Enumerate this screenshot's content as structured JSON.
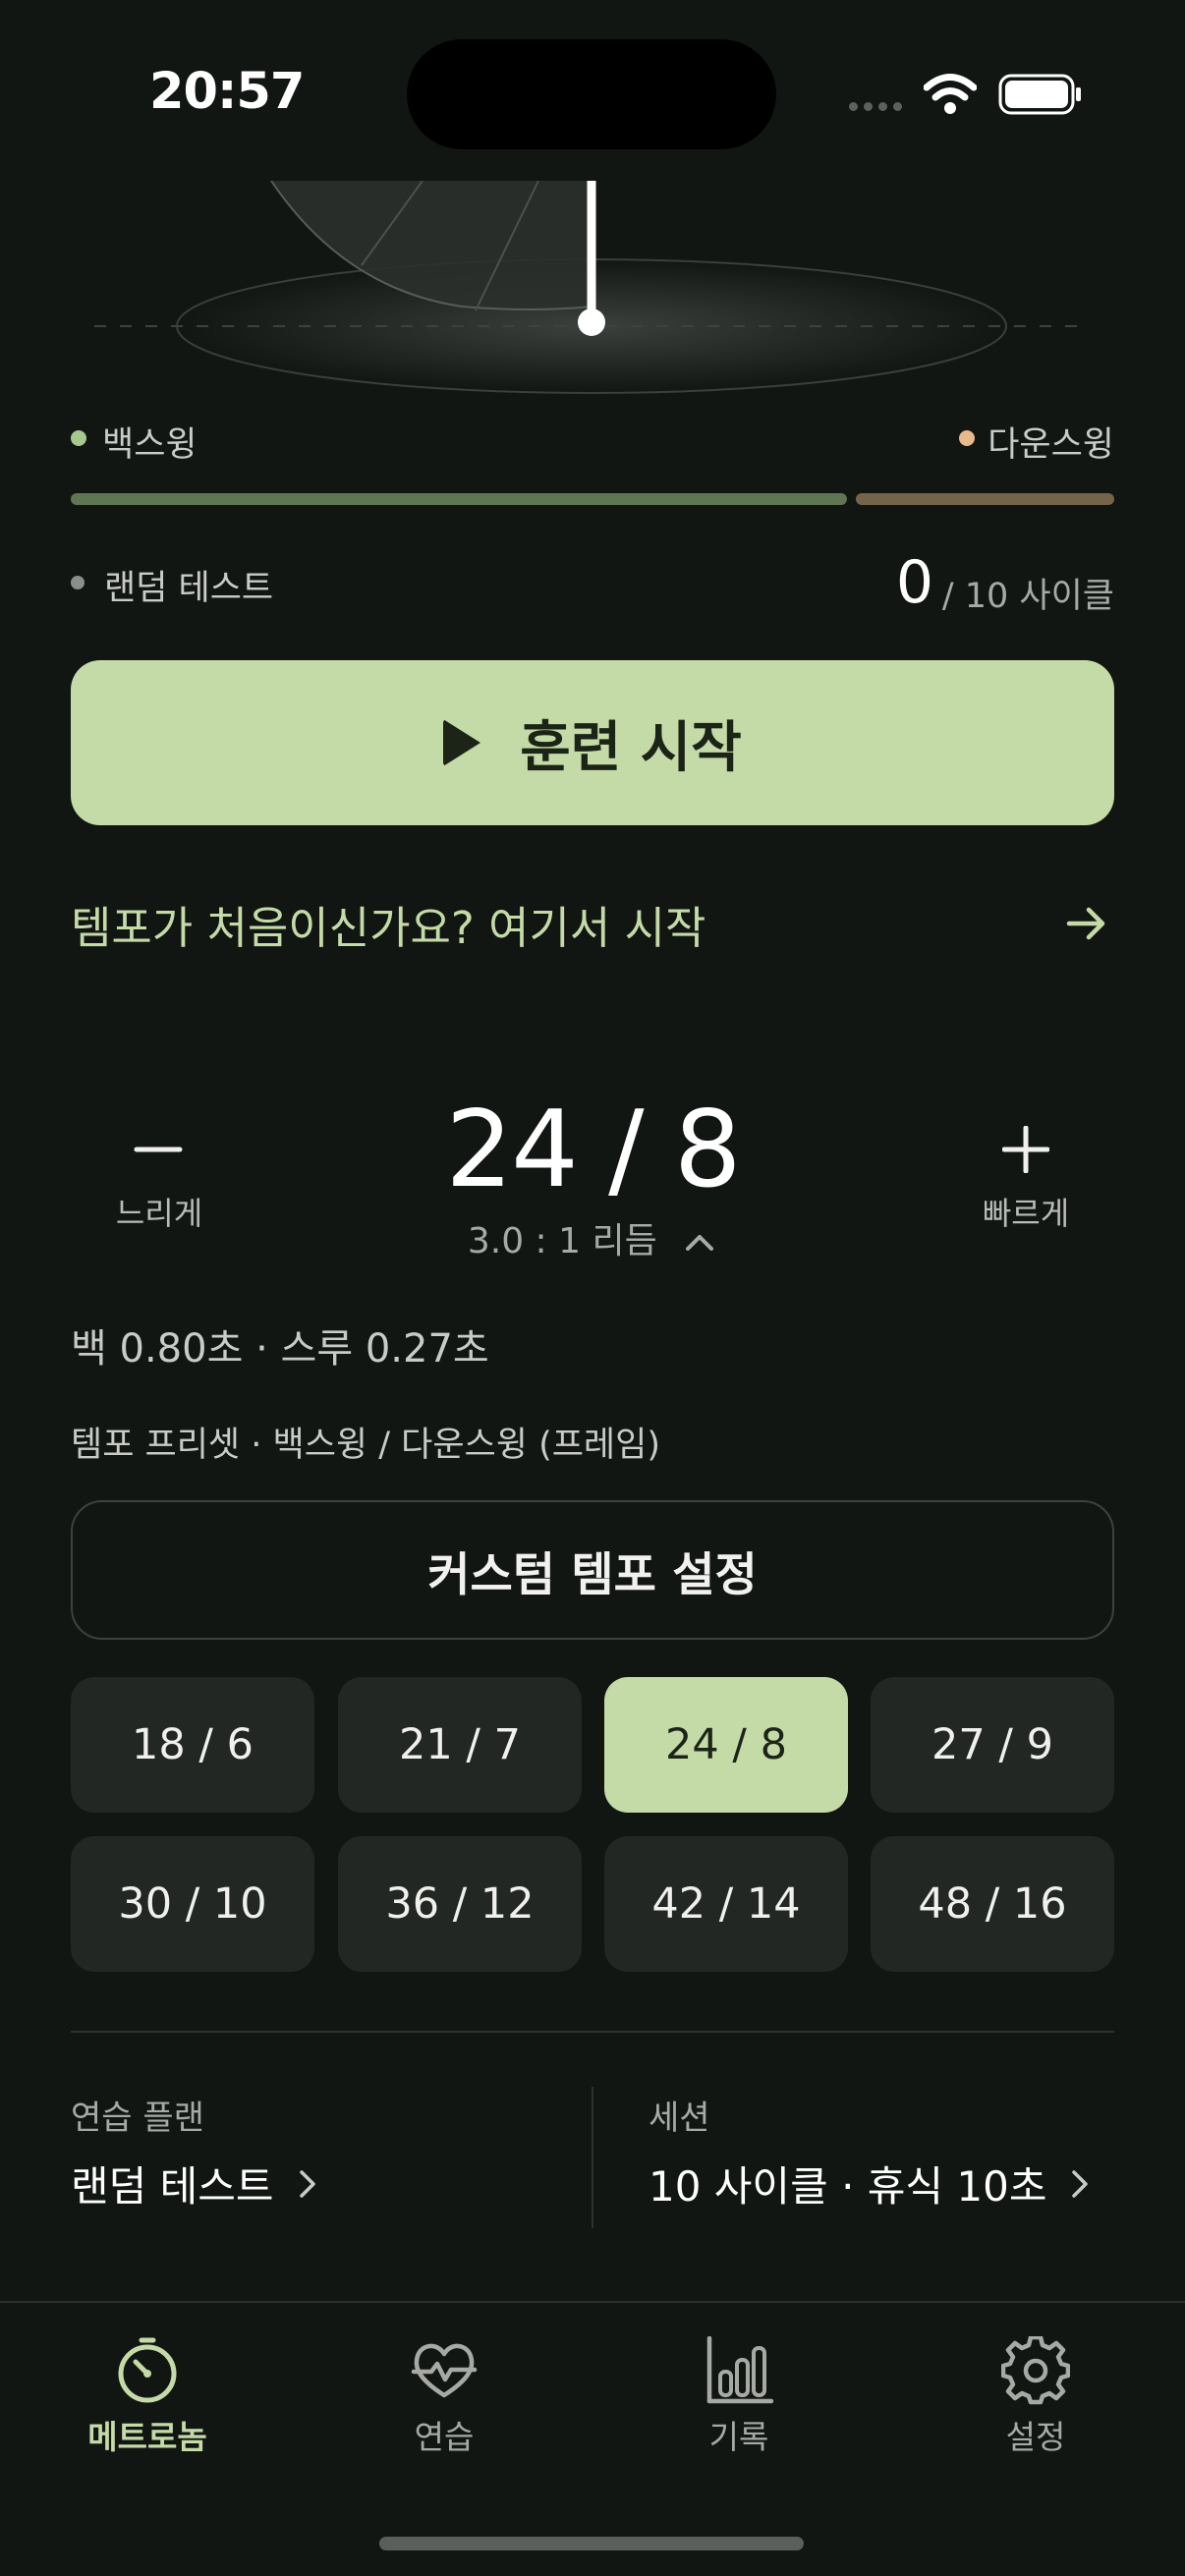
{
  "status_bar": {
    "time": "20:57"
  },
  "legend": {
    "back_label": "백스윙",
    "down_label": "다운스윙",
    "mode_label": "랜덤 테스트",
    "back_ratio": 0.75
  },
  "cycles": {
    "current": "0",
    "total_text": "/ 10 사이클"
  },
  "start_button": {
    "label": "훈련 시작"
  },
  "intro_link": {
    "label": "템포가 처음이신가요? 여기서 시작"
  },
  "tempo": {
    "back": "24",
    "slash": "/",
    "down": "8",
    "ratio": "3.0 : 1 리듬",
    "slower": "느리게",
    "faster": "빠르게"
  },
  "timing": {
    "text": "백 0.80초 · 스루 0.27초"
  },
  "presets": {
    "title": "템포 프리셋 · 백스윙 / 다운스윙 (프레임)",
    "custom_label": "커스텀 템포 설정",
    "items": [
      "18 / 6",
      "21 / 7",
      "24 / 8",
      "27 / 9",
      "30 / 10",
      "36 / 12",
      "42 / 14",
      "48 / 16"
    ],
    "active": "24 / 8"
  },
  "plan": {
    "caption": "연습 플랜",
    "value": "랜덤 테스트",
    "session_caption": "세션",
    "session_value": "10 사이클 · 휴식 10초"
  },
  "nav": {
    "items": [
      "메트로놈",
      "연습",
      "기록",
      "설정"
    ],
    "active": "메트로놈"
  },
  "colors": {
    "background": "#121613",
    "accent": "#c4dba7",
    "back_dot": "#a6c98d",
    "down_dot": "#e8b98a",
    "mode_dot": "#8b8f8b"
  }
}
